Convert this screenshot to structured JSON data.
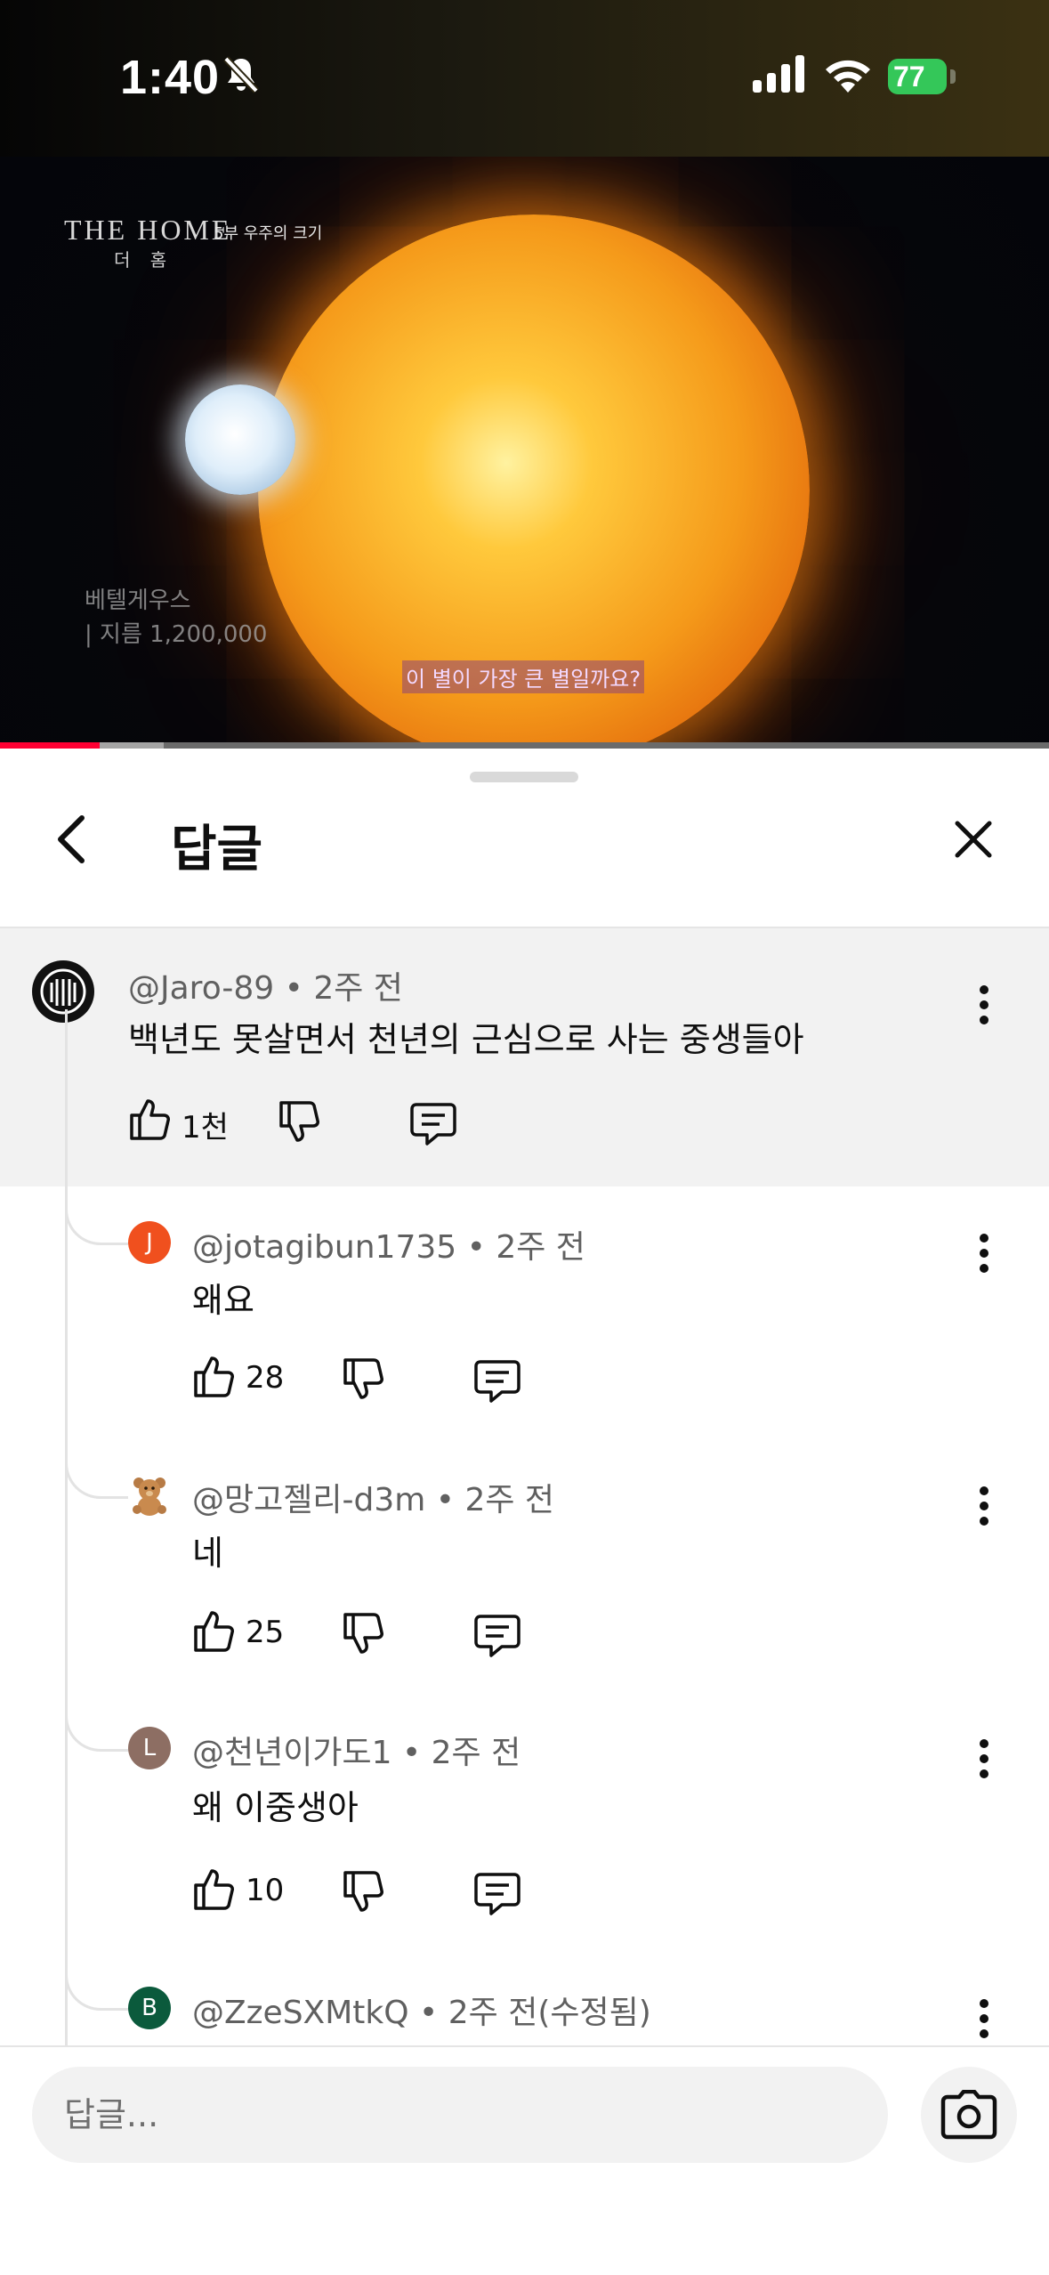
{
  "status_bar": {
    "time": "1:40",
    "battery": "77"
  },
  "video": {
    "title": "THE HOME",
    "subtitle": "5부 우주의 크기",
    "title_korean": "더 홈",
    "label_name": "베텔게우스",
    "label_diameter": "| 지름 1,200,000",
    "caption": "이 별이 가장 큰 별일까요?",
    "progress_played_fraction": 0.095
  },
  "sheet": {
    "title": "답글"
  },
  "main_comment": {
    "author": "@Jaro-89",
    "time": "2주 전",
    "text": "백년도 못살면서 천년의 근심으로 사는 중생들아",
    "likes": "1천"
  },
  "replies": [
    {
      "author": "@jotagibun1735",
      "time": "2주 전",
      "text": "왜요",
      "likes": "28",
      "avatar_letter": "J",
      "avatar_color": "#f0501e"
    },
    {
      "author": "@망고젤리-d3m",
      "time": "2주 전",
      "text": "네",
      "likes": "25",
      "avatar_letter": "",
      "avatar_color": "#ffffff"
    },
    {
      "author": "@천년이가도1",
      "time": "2주 전",
      "text": "왜 이중생아",
      "likes": "10",
      "avatar_letter": "L",
      "avatar_color": "#8d6e63"
    },
    {
      "author": "@ZzeSXMtkQ",
      "time": "2주 전(수정됨)",
      "text": "",
      "likes": "",
      "avatar_letter": "B",
      "avatar_color": "#0b5a3c"
    }
  ],
  "reply_input": {
    "placeholder": "답글..."
  },
  "icons": {
    "back": "chevron-left-icon",
    "close": "close-icon",
    "like": "thumbs-up-icon",
    "dislike": "thumbs-down-icon",
    "reply": "comment-icon",
    "more": "more-vertical-icon",
    "camera": "camera-icon"
  }
}
